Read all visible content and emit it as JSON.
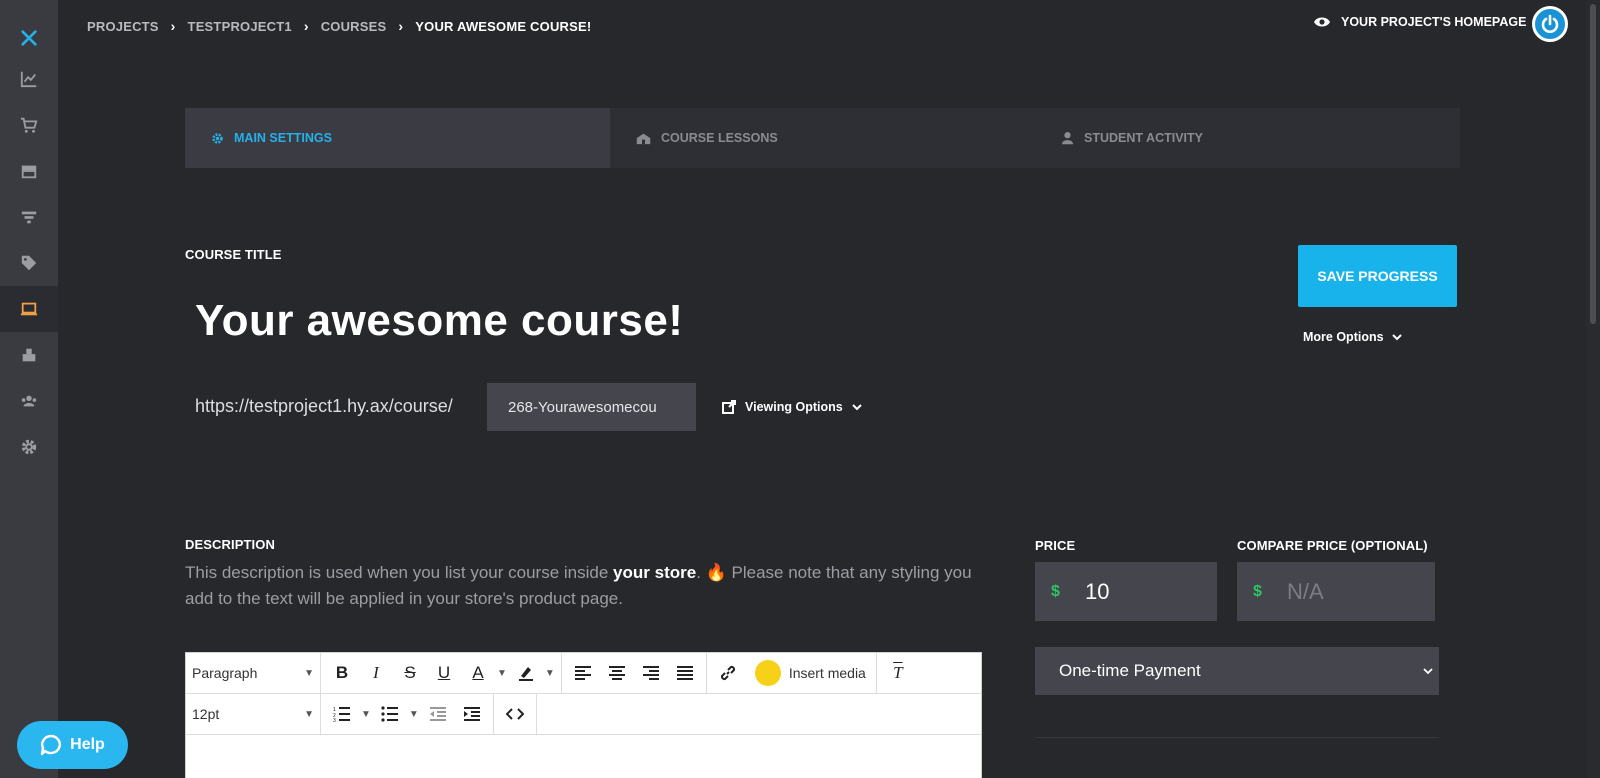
{
  "breadcrumb": {
    "items": [
      "PROJECTS",
      "TESTPROJECT1",
      "COURSES"
    ],
    "current": "YOUR AWESOME COURSE!"
  },
  "header": {
    "homepage_link": "YOUR PROJECT'S HOMEPAGE"
  },
  "sidebar": {
    "items": [
      {
        "icon": "logo-icon"
      },
      {
        "icon": "analytics-icon"
      },
      {
        "icon": "cart-icon"
      },
      {
        "icon": "store-icon"
      },
      {
        "icon": "funnel-icon"
      },
      {
        "icon": "tags-icon"
      },
      {
        "icon": "courses-icon",
        "active": true
      },
      {
        "icon": "products-icon"
      },
      {
        "icon": "users-icon"
      },
      {
        "icon": "settings-icon"
      }
    ]
  },
  "tabs": [
    {
      "label": "MAIN SETTINGS",
      "icon": "gear-icon",
      "active": true
    },
    {
      "label": "COURSE LESSONS",
      "icon": "school-icon"
    },
    {
      "label": "STUDENT ACTIVITY",
      "icon": "student-icon"
    }
  ],
  "course": {
    "title_label": "COURSE TITLE",
    "title": "Your awesome course!",
    "url_prefix": "https://testproject1.hy.ax/course/",
    "slug": "268-Yourawesomecou",
    "viewing_options": "Viewing Options",
    "save_label": "SAVE PROGRESS",
    "more_options": "More Options"
  },
  "description": {
    "label": "DESCRIPTION",
    "text_before": "This description is used when you list your course inside ",
    "text_bold": "your store",
    "text_after": ". 🔥 Please note that any styling you add to the text will be applied in your store's product page."
  },
  "pricing": {
    "price_label": "PRICE",
    "compare_label": "COMPARE PRICE (OPTIONAL)",
    "currency": "$",
    "price": "10",
    "compare_placeholder": "N/A",
    "payment_type": "One-time Payment"
  },
  "editor": {
    "block_format": "Paragraph",
    "font_size": "12pt",
    "insert_media": "Insert media"
  },
  "help": {
    "label": "Help"
  },
  "colors": {
    "accent": "#17b3ea",
    "currency": "#2ec563",
    "sidebar_active": "#f0a045"
  }
}
